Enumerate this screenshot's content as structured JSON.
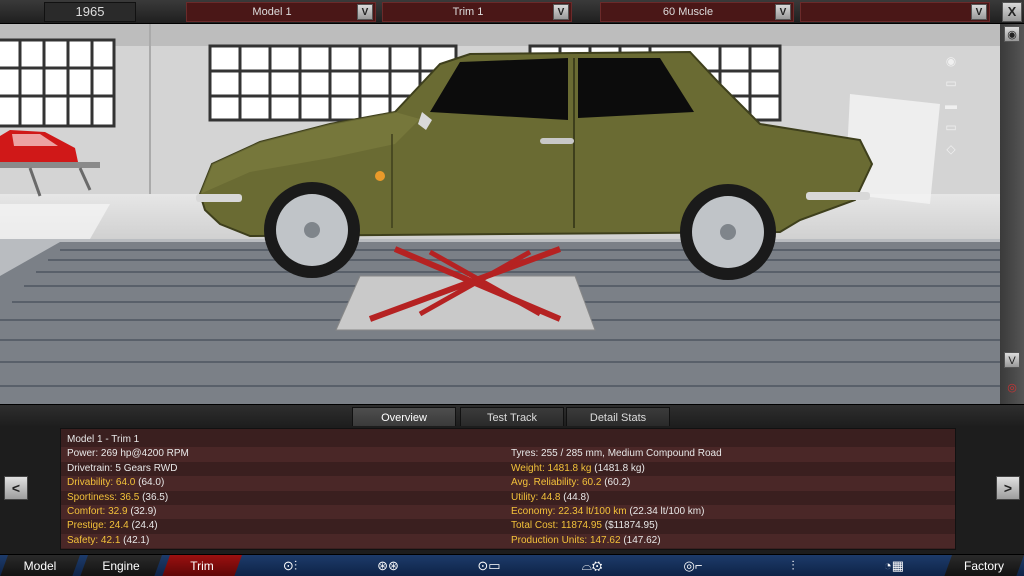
{
  "topbar": {
    "year": "1965",
    "model": "Model 1",
    "trim": "Trim 1",
    "style": "60 Muscle",
    "extra": "",
    "dropdown_glyph": "V",
    "close_glyph": "X"
  },
  "rail": {
    "up": "∧",
    "down": "V"
  },
  "tabs": {
    "overview": "Overview",
    "test_track": "Test Track",
    "detail_stats": "Detail Stats"
  },
  "overview": {
    "header": "Model 1 - Trim 1",
    "left": [
      {
        "label": "Power:",
        "value": "269 hp@4200 RPM",
        "highlight": false
      },
      {
        "label": "Drivetrain:",
        "value": "5 Gears RWD",
        "highlight": false
      },
      {
        "label": "Drivability:",
        "value": "64.0",
        "extra": "(64.0)",
        "highlight": true
      },
      {
        "label": "Sportiness:",
        "value": "36.5",
        "extra": "(36.5)",
        "highlight": true
      },
      {
        "label": "Comfort:",
        "value": "32.9",
        "extra": "(32.9)",
        "highlight": true
      },
      {
        "label": "Prestige:",
        "value": "24.4",
        "extra": "(24.4)",
        "highlight": true
      },
      {
        "label": "Safety:",
        "value": "42.1",
        "extra": "(42.1)",
        "highlight": true
      }
    ],
    "right": [
      {
        "label": "Tyres:",
        "value": "255 / 285 mm, Medium Compound Road",
        "highlight": false
      },
      {
        "label": "Weight:",
        "value": "1481.8 kg",
        "extra": "(1481.8 kg)",
        "highlight": true
      },
      {
        "label": "Avg. Reliability:",
        "value": "60.2",
        "extra": "(60.2)",
        "highlight": true
      },
      {
        "label": "Utility:",
        "value": "44.8",
        "extra": "(44.8)",
        "highlight": true
      },
      {
        "label": "Economy:",
        "value": "22.34 lt/100 km",
        "extra": "(22.34 lt/100 km)",
        "highlight": true
      },
      {
        "label": "Total Cost:",
        "value": "11874.95",
        "extra": "($11874.95)",
        "highlight": true
      },
      {
        "label": "Production Units:",
        "value": "147.62",
        "extra": "(147.62)",
        "highlight": true
      }
    ]
  },
  "panel_nav": {
    "prev": "<",
    "next": ">"
  },
  "bottom_nav": {
    "model": "Model",
    "engine": "Engine",
    "trim": "Trim",
    "factory": "Factory"
  },
  "colors": {
    "car_body": "#6a6b33",
    "accent_red": "#9b1010",
    "highlight_yellow": "#f2c13a"
  }
}
